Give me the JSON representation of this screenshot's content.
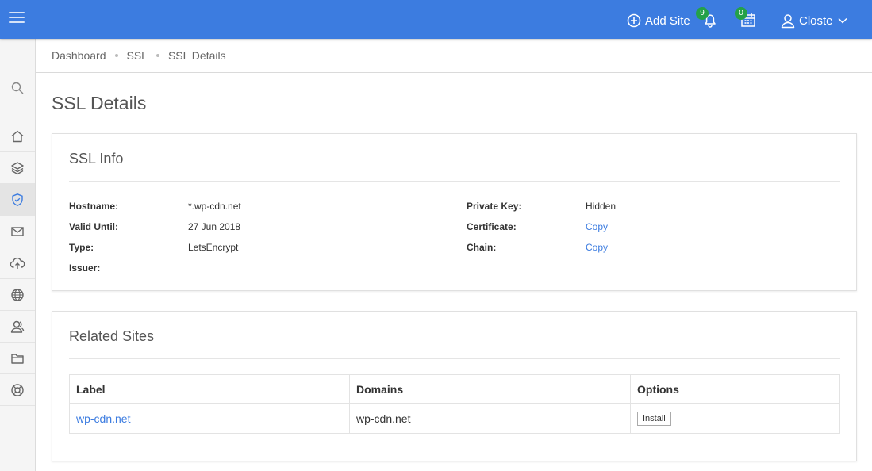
{
  "topbar": {
    "add_site_label": "Add Site",
    "notifications_count": "9",
    "tasks_count": "0",
    "user_name": "Closte"
  },
  "breadcrumb": [
    "Dashboard",
    "SSL",
    "SSL Details"
  ],
  "page": {
    "title": "SSL Details"
  },
  "ssl_info": {
    "title": "SSL Info",
    "hostname_label": "Hostname:",
    "hostname_value": "*.wp-cdn.net",
    "valid_until_label": "Valid Until:",
    "valid_until_value": "27 Jun 2018",
    "type_label": "Type:",
    "type_value": "LetsEncrypt",
    "issuer_label": "Issuer:",
    "private_key_label": "Private Key:",
    "private_key_value": "Hidden",
    "certificate_label": "Certificate:",
    "certificate_value": "Copy",
    "chain_label": "Chain:",
    "chain_value": "Copy"
  },
  "related_sites": {
    "title": "Related Sites",
    "columns": [
      "Label",
      "Domains",
      "Options"
    ],
    "rows": [
      {
        "label": "wp-cdn.net",
        "domains": "wp-cdn.net",
        "option": "Install"
      }
    ]
  },
  "colors": {
    "topbar": "#3c7ce0",
    "link": "#3c7ce0",
    "badge": "#24a148"
  }
}
